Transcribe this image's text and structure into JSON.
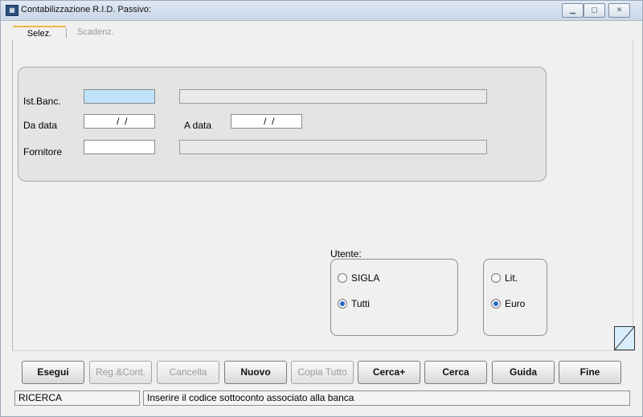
{
  "window": {
    "title": "Contabilizzazione R.I.D. Passivo:",
    "app_icon": "window-app-icon",
    "controls": [
      "minimize-icon",
      "maximize-icon",
      "close-icon"
    ]
  },
  "tabs": [
    {
      "label": "Selez."
    },
    {
      "label": "Scadenz."
    }
  ],
  "form": {
    "ist_banc_label": "Ist.Banc.",
    "ist_banc_value": "",
    "ist_banc_desc": "",
    "da_data_label": "Da data",
    "da_data_value": "  /  /",
    "a_data_label": "A data",
    "a_data_value": "  /  /",
    "fornitore_label": "Fornitore",
    "fornitore_value": "",
    "fornitore_desc": ""
  },
  "utente": {
    "label": "Utente:",
    "options": [
      {
        "label": "SIGLA",
        "selected": false
      },
      {
        "label": "Tutti",
        "selected": true
      }
    ]
  },
  "currency": {
    "options": [
      {
        "label": "Lit.",
        "selected": false
      },
      {
        "label": "Euro",
        "selected": true
      }
    ]
  },
  "buttons": [
    {
      "label": "Esegui",
      "enabled": true
    },
    {
      "label": "Reg.&Cont.",
      "enabled": false
    },
    {
      "label": "Cancella",
      "enabled": false
    },
    {
      "label": "Nuovo",
      "enabled": true
    },
    {
      "label": "Copia Tutto",
      "enabled": false
    },
    {
      "label": "Cerca+",
      "enabled": true
    },
    {
      "label": "Cerca",
      "enabled": true
    },
    {
      "label": "Guida",
      "enabled": true
    },
    {
      "label": "Fine",
      "enabled": true
    }
  ],
  "status": {
    "mode": "RICERCA",
    "message": "Inserire il codice sottoconto associato alla banca"
  },
  "colors": {
    "accent_tab": "#f0b44c",
    "blue_field": "#bfe3fb",
    "radio_selected": "#2566c7"
  }
}
